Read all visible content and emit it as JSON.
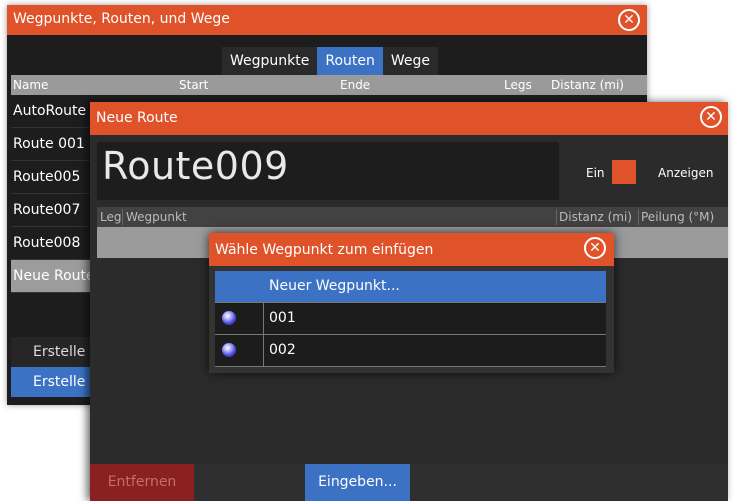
{
  "back_window": {
    "title": "Wegpunkte, Routen, und Wege",
    "tabs": [
      {
        "label": "Wegpunkte",
        "active": false
      },
      {
        "label": "Routen",
        "active": true
      },
      {
        "label": "Wege",
        "active": false
      }
    ],
    "columns": [
      "Name",
      "Start",
      "Ende",
      "Legs",
      "Distanz (mi)"
    ],
    "rows": [
      "AutoRoute",
      "Route 001",
      "Route005",
      "Route007",
      "Route008",
      "Neue Route"
    ],
    "buttons": [
      "Erstelle",
      "Erstelle"
    ]
  },
  "route_window": {
    "title": "Neue Route",
    "route_name": "Route009",
    "toggle_label": "Ein",
    "show_label": "Anzeigen",
    "columns": [
      "Leg",
      "Wegpunkt",
      "Distanz (mi)",
      "Peilung (°M)"
    ],
    "remove_button": "Entfernen",
    "enter_button": "Eingeben..."
  },
  "waypoint_dialog": {
    "title": "Wähle Wegpunkt zum einfügen",
    "items": [
      {
        "label": "Neuer Wegpunkt...",
        "icon": "none"
      },
      {
        "label": "001",
        "icon": "waypoint-dot-icon"
      },
      {
        "label": "002",
        "icon": "waypoint-dot-icon"
      }
    ]
  },
  "colors": {
    "accent_orange": "#e0532a",
    "highlight_blue": "#3b72c4",
    "remove_red": "#8a2020"
  }
}
